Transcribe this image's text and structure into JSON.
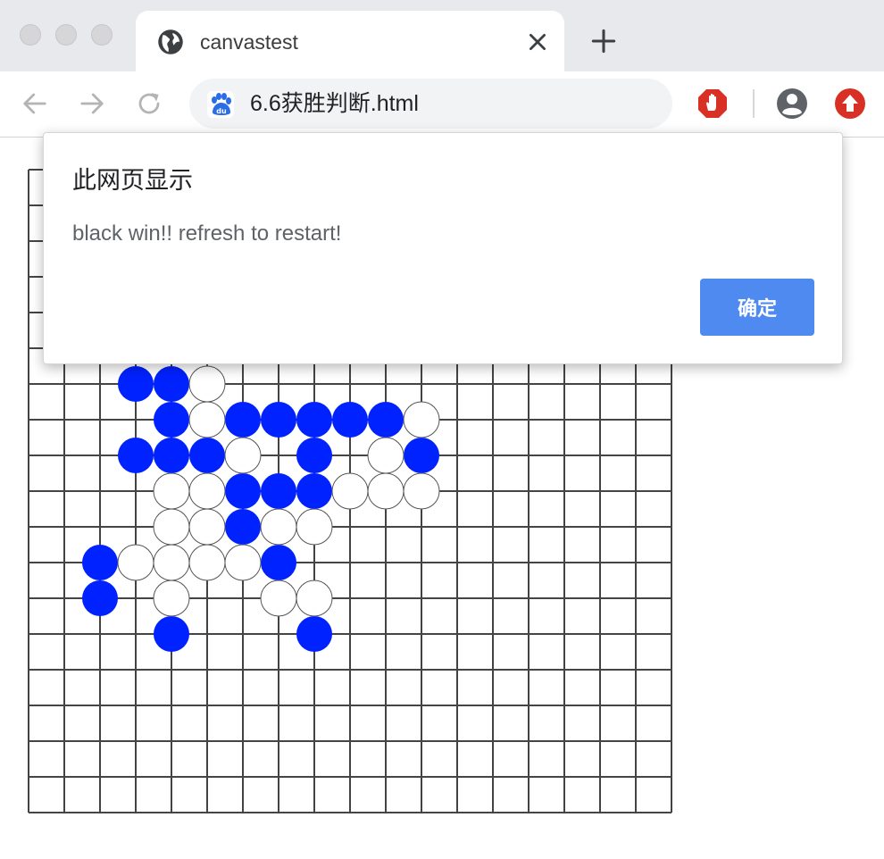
{
  "window": {
    "tab_title": "canvastest",
    "address": "6.6获胜判断.html"
  },
  "icons": {
    "tab": "globe-icon",
    "back": "arrow-left-icon",
    "forward": "arrow-right-icon",
    "reload": "reload-icon",
    "site": "baidu-paw-icon",
    "ext1": "adblock-hand-icon",
    "account": "account-circle-icon",
    "ext2": "upload-arrow-icon",
    "close": "close-icon",
    "new_tab": "plus-icon"
  },
  "dialog": {
    "title": "此网页显示",
    "message": "black win!! refresh to restart!",
    "ok_label": "确定"
  },
  "colors": {
    "black_stone": "#0022ff",
    "white_stone": "#ffffff",
    "grid": "#444444",
    "ok_button": "#4f8af1",
    "ext_red": "#d93025"
  },
  "board": {
    "lines": 18,
    "black_stones": [
      [
        3,
        6
      ],
      [
        4,
        6
      ],
      [
        4,
        7
      ],
      [
        6,
        7
      ],
      [
        7,
        7
      ],
      [
        8,
        7
      ],
      [
        9,
        7
      ],
      [
        10,
        7
      ],
      [
        3,
        8
      ],
      [
        4,
        8
      ],
      [
        5,
        8
      ],
      [
        8,
        8
      ],
      [
        11,
        8
      ],
      [
        6,
        9
      ],
      [
        7,
        9
      ],
      [
        8,
        9
      ],
      [
        6,
        10
      ],
      [
        2,
        11
      ],
      [
        7,
        11
      ],
      [
        2,
        12
      ],
      [
        4,
        13
      ],
      [
        8,
        13
      ]
    ],
    "white_stones": [
      [
        5,
        6
      ],
      [
        5,
        7
      ],
      [
        11,
        7
      ],
      [
        6,
        8
      ],
      [
        10,
        8
      ],
      [
        4,
        9
      ],
      [
        5,
        9
      ],
      [
        9,
        9
      ],
      [
        10,
        9
      ],
      [
        11,
        9
      ],
      [
        4,
        10
      ],
      [
        5,
        10
      ],
      [
        7,
        10
      ],
      [
        8,
        10
      ],
      [
        3,
        11
      ],
      [
        4,
        11
      ],
      [
        5,
        11
      ],
      [
        6,
        11
      ],
      [
        4,
        12
      ],
      [
        7,
        12
      ],
      [
        8,
        12
      ]
    ]
  }
}
